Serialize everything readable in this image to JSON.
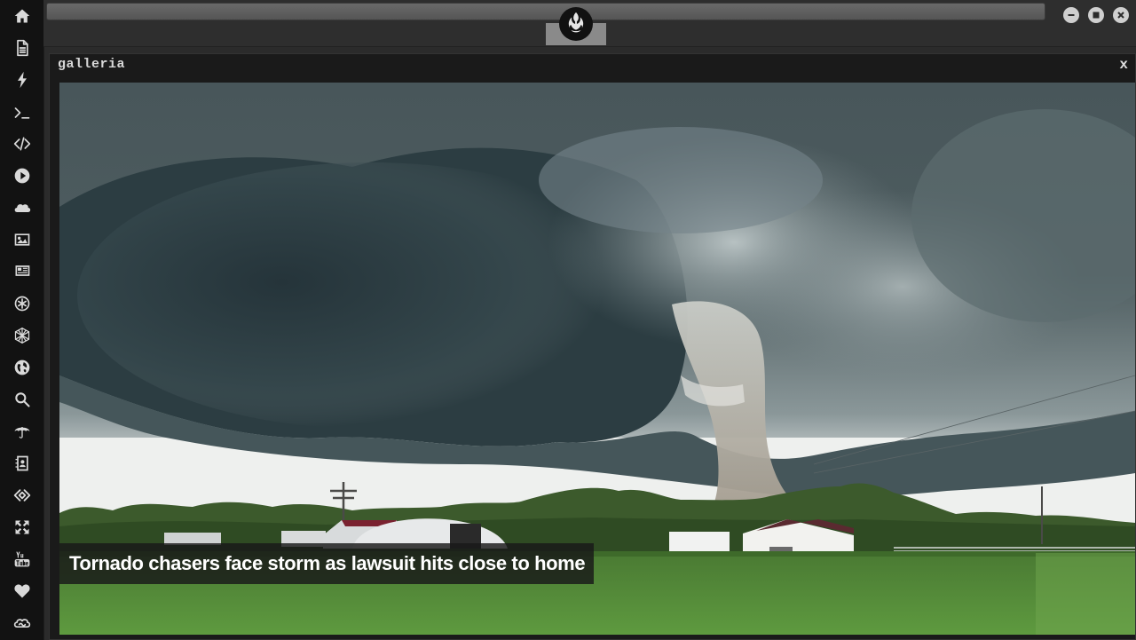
{
  "window": {
    "title": "galleria",
    "close_label": "x"
  },
  "gallery": {
    "caption": "Tornado chasers face storm as lawsuit hits close to home"
  },
  "sidebar": {
    "items": [
      {
        "icon": "home-icon"
      },
      {
        "icon": "document-icon"
      },
      {
        "icon": "lightning-icon"
      },
      {
        "icon": "terminal-icon"
      },
      {
        "icon": "code-icon"
      },
      {
        "icon": "play-icon"
      },
      {
        "icon": "cloud-icon"
      },
      {
        "icon": "image-icon"
      },
      {
        "icon": "newspaper-icon"
      },
      {
        "icon": "asterisk-circle-icon"
      },
      {
        "icon": "hexagon-network-icon"
      },
      {
        "icon": "globe-icon"
      },
      {
        "icon": "search-icon"
      },
      {
        "icon": "umbrella-icon"
      },
      {
        "icon": "contacts-icon"
      },
      {
        "icon": "code-diamond-icon"
      },
      {
        "icon": "expand-icon"
      },
      {
        "icon": "youtube-icon"
      },
      {
        "icon": "heart-icon"
      },
      {
        "icon": "infinity-cloud-icon"
      }
    ]
  },
  "topbar": {
    "logo": "rebel-alliance-icon",
    "window_controls": [
      "minimize-icon",
      "maximize-icon",
      "close-icon"
    ]
  },
  "colors": {
    "sidebar_bg": "#121212",
    "topbar_bg": "#2e2e2e",
    "window_bg": "#1a1a1a",
    "caption_bg": "#191919"
  }
}
